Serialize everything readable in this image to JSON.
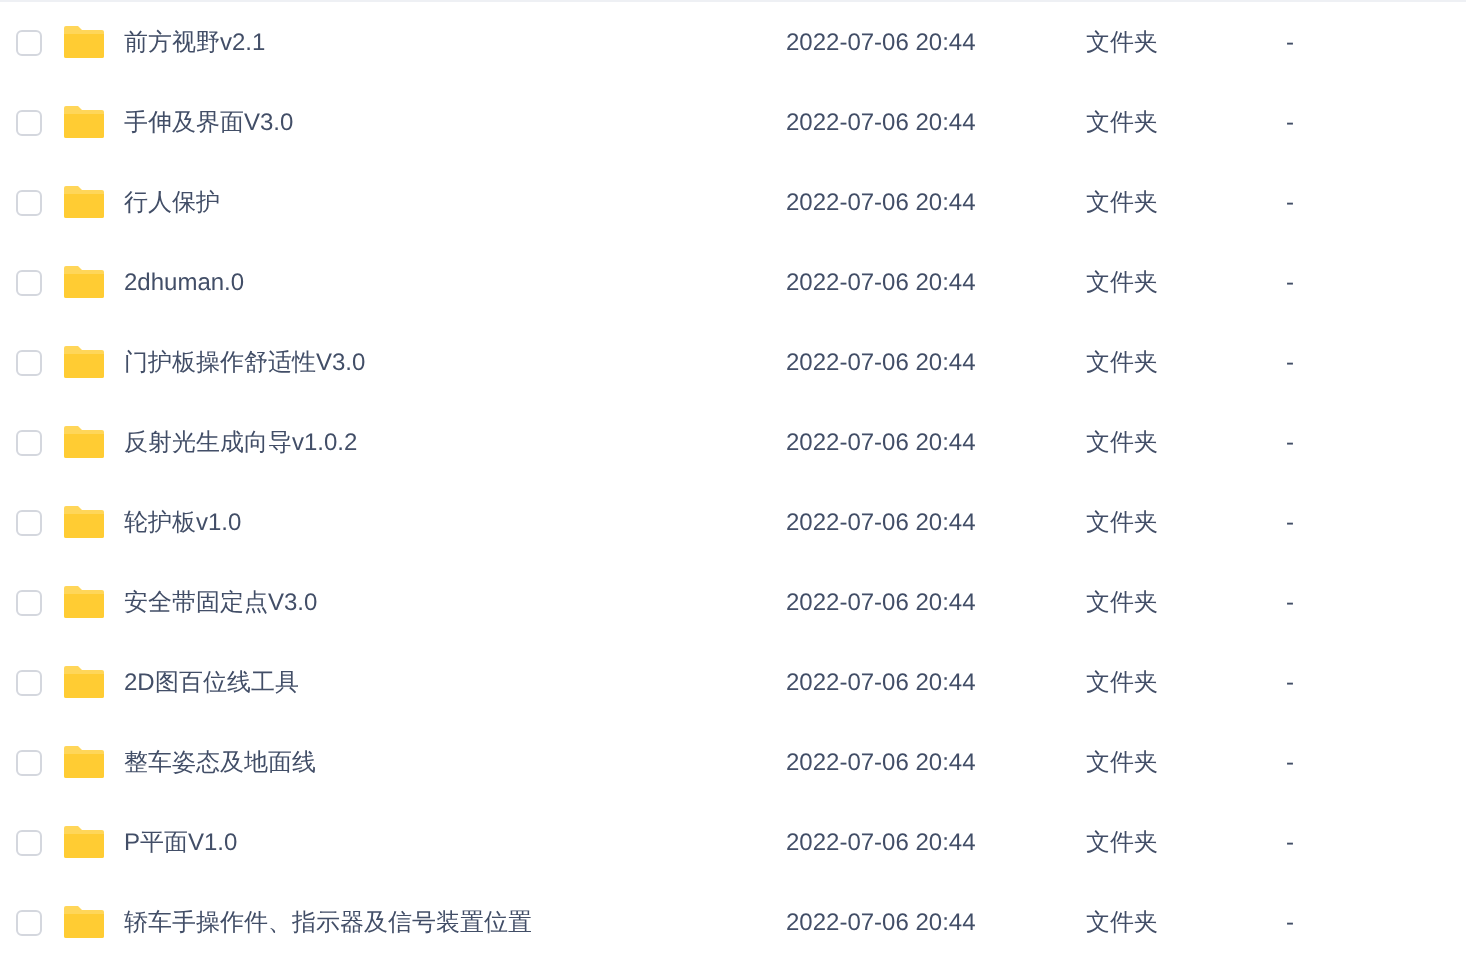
{
  "files": [
    {
      "name": "前方视野v2.1",
      "modified": "2022-07-06 20:44",
      "type": "文件夹",
      "size": "-",
      "selected": false
    },
    {
      "name": "手伸及界面V3.0",
      "modified": "2022-07-06 20:44",
      "type": "文件夹",
      "size": "-",
      "selected": false
    },
    {
      "name": "行人保护",
      "modified": "2022-07-06 20:44",
      "type": "文件夹",
      "size": "-",
      "selected": false
    },
    {
      "name": "2dhuman.0",
      "modified": "2022-07-06 20:44",
      "type": "文件夹",
      "size": "-",
      "selected": false
    },
    {
      "name": "门护板操作舒适性V3.0",
      "modified": "2022-07-06 20:44",
      "type": "文件夹",
      "size": "-",
      "selected": false
    },
    {
      "name": "反射光生成向导v1.0.2",
      "modified": "2022-07-06 20:44",
      "type": "文件夹",
      "size": "-",
      "selected": false
    },
    {
      "name": "轮护板v1.0",
      "modified": "2022-07-06 20:44",
      "type": "文件夹",
      "size": "-",
      "selected": false
    },
    {
      "name": "安全带固定点V3.0",
      "modified": "2022-07-06 20:44",
      "type": "文件夹",
      "size": "-",
      "selected": false
    },
    {
      "name": "2D图百位线工具",
      "modified": "2022-07-06 20:44",
      "type": "文件夹",
      "size": "-",
      "selected": false
    },
    {
      "name": "整车姿态及地面线",
      "modified": "2022-07-06 20:44",
      "type": "文件夹",
      "size": "-",
      "selected": false
    },
    {
      "name": "P平面V1.0",
      "modified": "2022-07-06 20:44",
      "type": "文件夹",
      "size": "-",
      "selected": false
    },
    {
      "name": "轿车手操作件、指示器及信号装置位置",
      "modified": "2022-07-06 20:44",
      "type": "文件夹",
      "size": "-",
      "selected": false
    }
  ]
}
